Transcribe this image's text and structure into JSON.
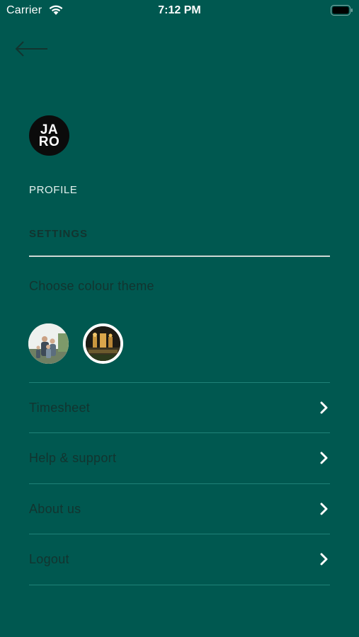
{
  "status_bar": {
    "carrier": "Carrier",
    "time": "7:12 PM"
  },
  "logo": {
    "line1": "JA",
    "line2": "RO"
  },
  "nav": {
    "profile": "PROFILE",
    "settings": "SETTINGS"
  },
  "theme": {
    "heading": "Choose colour theme"
  },
  "menu": {
    "items": [
      {
        "label": "Timesheet"
      },
      {
        "label": "Help & support"
      },
      {
        "label": "About us"
      },
      {
        "label": "Logout"
      }
    ]
  },
  "colors": {
    "background": "#005850",
    "divider": "#1f8278",
    "text_dark": "#12342f",
    "text_light": "#e4f2ef"
  },
  "icons": {
    "back": "arrow-left-icon",
    "chevron": "chevron-right-icon",
    "wifi": "wifi-icon",
    "battery": "battery-icon"
  }
}
